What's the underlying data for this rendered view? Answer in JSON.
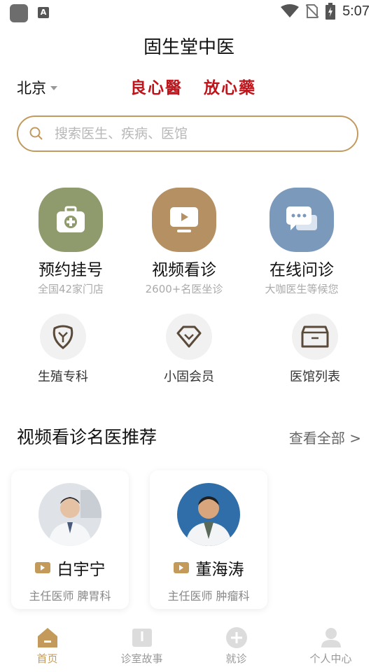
{
  "status_bar": {
    "time": "5:07"
  },
  "header": {
    "title": "固生堂中医",
    "city": "北京",
    "slogan": "良心醫   放心藥"
  },
  "search": {
    "placeholder": "搜索医生、疾病、医馆"
  },
  "features": [
    {
      "title": "预约挂号",
      "subtitle": "全国42家门店",
      "color": "#8f9b6d",
      "icon": "medical-kit-icon"
    },
    {
      "title": "视频看诊",
      "subtitle": "2600+名医坐诊",
      "color": "#b59063",
      "icon": "video-play-icon"
    },
    {
      "title": "在线问诊",
      "subtitle": "大咖医生等候您",
      "color": "#7b99bb",
      "icon": "chat-bubble-icon"
    }
  ],
  "shortcuts": [
    {
      "label": "生殖专科",
      "icon": "tooth-shield-icon"
    },
    {
      "label": "小固会员",
      "icon": "diamond-badge-icon"
    },
    {
      "label": "医馆列表",
      "icon": "clinic-box-icon"
    }
  ],
  "section": {
    "title": "视频看诊名医推荐",
    "more": "查看全部 >"
  },
  "doctors": [
    {
      "name": "白宇宁",
      "desc": "主任医师 脾胃科"
    },
    {
      "name": "董海涛",
      "desc": "主任医师 肿瘤科"
    }
  ],
  "tabs": [
    {
      "label": "首页",
      "icon": "home-icon",
      "active": true
    },
    {
      "label": "诊室故事",
      "icon": "book-icon",
      "active": false
    },
    {
      "label": "就诊",
      "icon": "plus-circle-icon",
      "active": false
    },
    {
      "label": "个人中心",
      "icon": "person-icon",
      "active": false
    }
  ],
  "colors": {
    "accent": "#c49a5a",
    "slogan": "#c0141b",
    "search_border": "#c29a5e"
  }
}
